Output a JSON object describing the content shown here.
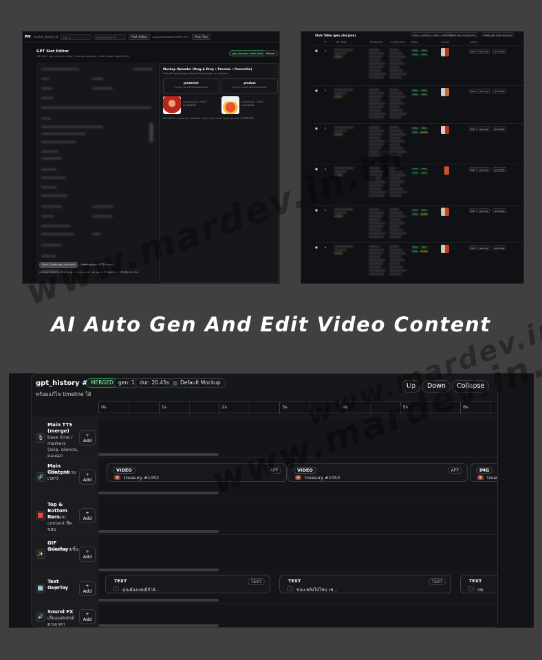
{
  "heading": "AI Auto Gen And Edit Video Content",
  "watermark": "www.mardev.in.th",
  "slot_editor": {
    "logo": "PM",
    "branch": "master_history_id",
    "search_placeholder": "e.g. 3",
    "history_placeholder": "Gpt History Id",
    "push_editor": "Push Editor",
    "guard_label": "Guard:Write back the Part PM 2",
    "push_text": "Push Text",
    "title": "GPT Slot Editor",
    "subtitle": "HID 441 • gen_slot.json editor • Mockup uploader • Anti handoff logs (Part 2)",
    "lock_pill": "gen_slot.json: mtim (locked)",
    "reload": "Reload",
    "uploader_title": "Mockup Uploader (Drag & Drop • Preview • Overwrite)",
    "uploader_sub": "อัปโหลดไป uploads/gpt_history/441/presenter/ และ product/",
    "slots": [
      {
        "name": "presenter",
        "desc": "ลากรูปมาวางตรงนี้ หรือคลิกเพื่อเลือกไฟล์",
        "file": "presenter.png • mtime",
        "ts": "1772328767"
      },
      {
        "name": "product",
        "desc": "ลากรูปมาวางตรงนี้ หรือคลิกเพื่อเลือกไฟล์",
        "file": "product.png • mtime",
        "ts": "1772328767"
      }
    ],
    "uploader_foot": "ทิป:โหลดใหม่ • overwrite • invalidate runtime (UAS) cache ใน gen_slot.json (ถ้ามีให้ดับเบิ้ล)",
    "start_button": "Start (Create gen_slot.json)",
    "continue_label": "Continue (Ask GPT2 Found)",
    "footnote": "Continue ไป Part 2 • ให้ GPT2 ต่อ • ทำงาน product • ลด handoff ที่ไม่ต้องมี Part 2 (ที่ใช้เป็น GPT เสริม)"
  },
  "slots_table": {
    "title": "Slots Table (gen_slot.json)",
    "tools": [
      "key k • prompt k • img k • video k",
      "Master Gen Img (bg only)",
      "Master Gen Video (bg only)"
    ],
    "columns": [
      "#",
      "key / flags",
      "prompt_img",
      "prompt_video",
      "status",
      "preview",
      "actions"
    ],
    "rows": [
      {
        "n": "1",
        "statuses": [
          [
            "done",
            "done"
          ],
          [
            "done",
            "done"
          ]
        ],
        "actions": [
          "Edit",
          "Gen Img",
          "Gen Video"
        ]
      },
      {
        "n": "2",
        "statuses": [
          [
            "done",
            "done"
          ],
          [
            "done",
            "done"
          ]
        ],
        "actions": [
          "Edit",
          "Gen Img",
          "Gen Video"
        ]
      },
      {
        "n": "3",
        "statuses": [
          [
            "done",
            "done"
          ],
          [
            "done",
            "pending"
          ]
        ],
        "actions": [
          "Edit",
          "Gen Img",
          "Gen Video"
        ]
      },
      {
        "n": "4",
        "statuses": [
          [
            "done",
            "done"
          ],
          [
            "done",
            "done"
          ]
        ],
        "actions": [
          "Edit",
          "Gen Img",
          "Gen Video"
        ]
      },
      {
        "n": "5",
        "statuses": [
          [
            "done",
            "done"
          ],
          [
            "done",
            "pending"
          ]
        ],
        "actions": [
          "Edit",
          "Gen Img",
          "Gen Video"
        ]
      },
      {
        "n": "6",
        "statuses": [
          [
            "done",
            "done"
          ],
          [
            "done",
            "pending"
          ]
        ],
        "actions": [
          "Edit",
          "Gen Img",
          "Gen Video"
        ]
      }
    ]
  },
  "timeline": {
    "title": "gpt_history #441",
    "badge": "MERGED",
    "gen": "gen: 1",
    "dur": "dur: 20.45s",
    "mockup": "Default Mockup",
    "subtitle": "พร้อมแก้ไข timeline ได้",
    "buttons": {
      "up": "Up",
      "down": "Down",
      "collapse": "Collapse"
    },
    "ticks": [
      "0s",
      "1s",
      "2s",
      "3s",
      "4s",
      "5s",
      "6s"
    ],
    "add_label": "+\nAdd",
    "tracks": [
      {
        "icon": "🎙",
        "title": "Main TTS (merge)",
        "desc": "base time / markers (skip, silence, pause)"
      },
      {
        "icon": "🔗",
        "title": "Main Content",
        "desc": "วิดีโอ/รูป (ตามเวลา)"
      },
      {
        "icon": "🟥",
        "title": "Top & Bottom Bars",
        "desc": "ทับ main content ชิดขอบ"
      },
      {
        "icon": "✨",
        "title": "GIF Overlay",
        "desc": "ทับไฟล์หลายชั้น"
      },
      {
        "icon": "🔤",
        "title": "Text Overlay",
        "desc": "บนสุด"
      },
      {
        "icon": "🔊",
        "title": "Sound FX",
        "desc": "เสียงเอฟเฟกต์ ตามเวลา"
      }
    ],
    "content_clips": [
      {
        "tag": "VIDEO",
        "kind": "APP",
        "name": "treasury #1052"
      },
      {
        "tag": "VIDEO",
        "kind": "APP",
        "name": "treasury #1053"
      },
      {
        "tag": "IMG",
        "kind": "",
        "name": "treas"
      }
    ],
    "text_clips": [
      {
        "tag": "TEXT",
        "kind": "TEXT",
        "name": "คุณต้องเคยมีกำลั..."
      },
      {
        "tag": "TEXT",
        "kind": "TEXT",
        "name": "ขณะหลังไปไหน เช..."
      },
      {
        "tag": "TEXT",
        "kind": "",
        "name": "กพ"
      }
    ]
  },
  "colors": {
    "accent_green": "#9ee6b4",
    "pending": "#f3c04d",
    "bg": "#404040"
  }
}
